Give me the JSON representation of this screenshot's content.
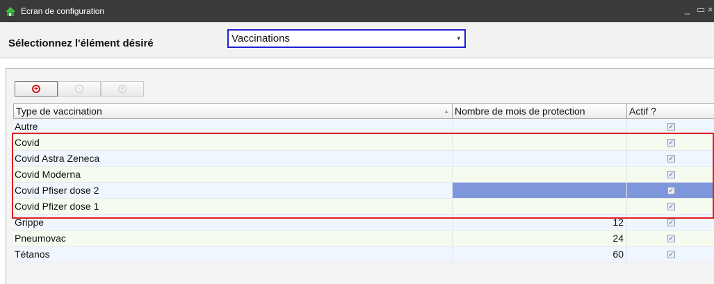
{
  "window": {
    "title": "Ecran de configuration",
    "minimize": "_",
    "maximize": "▭",
    "close": "×",
    "accent": "#1f1fd0"
  },
  "selector": {
    "label": "Sélectionnez l'élément désiré",
    "value": "Vaccinations",
    "arrow": "▾"
  },
  "toolbar": {
    "buttons": [
      {
        "icon": "add-icon",
        "glyph": "+",
        "enabled": true
      },
      {
        "icon": "edit-icon",
        "glyph": "·",
        "enabled": false
      },
      {
        "icon": "delete-icon",
        "glyph": "×",
        "enabled": false
      }
    ]
  },
  "grid": {
    "columns": [
      "Type de vaccination",
      "Nombre de mois de protection",
      "Actif ?"
    ],
    "sort_glyph": "▲",
    "rows": [
      {
        "type": "Autre",
        "months": "",
        "active": true
      },
      {
        "type": "Covid",
        "months": "",
        "active": true
      },
      {
        "type": "Covid Astra Zeneca",
        "months": "",
        "active": true
      },
      {
        "type": "Covid Moderna",
        "months": "",
        "active": true
      },
      {
        "type": "Covid Pfiser dose 2",
        "months": "",
        "active": true,
        "selected": true
      },
      {
        "type": "Covid Pfizer dose 1",
        "months": "",
        "active": true
      },
      {
        "type": "Grippe",
        "months": "12",
        "active": true
      },
      {
        "type": "Pneumovac",
        "months": "24",
        "active": true
      },
      {
        "type": "Tétanos",
        "months": "60",
        "active": true
      }
    ],
    "check_glyph": "✓",
    "selection_color": "#7e97dc",
    "highlight_color": "#e02020"
  }
}
